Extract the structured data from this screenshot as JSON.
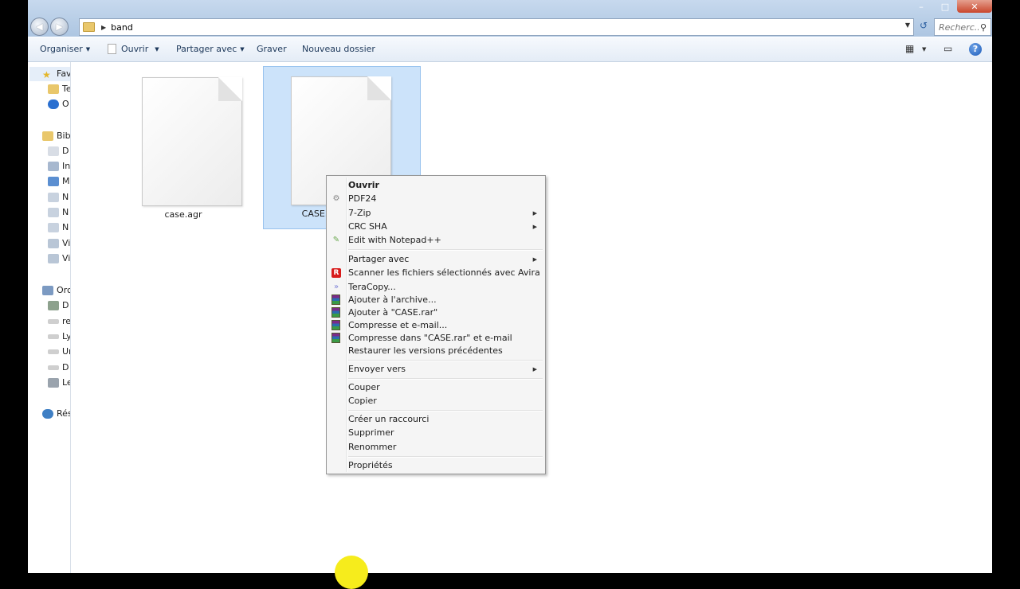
{
  "address": {
    "breadcrumb": [
      "band"
    ],
    "search_placeholder": "Recherc..."
  },
  "toolbar": {
    "organize": "Organiser",
    "open": "Ouvrir",
    "share": "Partager avec",
    "burn": "Graver",
    "new_folder": "Nouveau dossier"
  },
  "nav": {
    "favorites": "Fav",
    "fav_items": [
      "Te",
      "O"
    ],
    "libraries": "Bib",
    "lib_items": [
      "D",
      "In",
      "M",
      "N",
      "N",
      "N",
      "Vi",
      "Vi"
    ],
    "computer": "Orc",
    "computer_items": [
      "D",
      "re",
      "Ly",
      "Ur",
      "D",
      "Le"
    ],
    "network": "Rés"
  },
  "files": [
    {
      "name": "case.agr",
      "selected": false
    },
    {
      "name": "CASE.",
      "selected": true
    }
  ],
  "context_menu": {
    "items": [
      {
        "label": "Ouvrir",
        "bold": true
      },
      {
        "label": "PDF24",
        "icon": "pdf24-icon"
      },
      {
        "label": "7-Zip",
        "submenu": true
      },
      {
        "label": "CRC SHA",
        "submenu": true
      },
      {
        "label": "Edit with Notepad++",
        "icon": "notepadpp-icon"
      },
      {
        "label": "Partager avec",
        "submenu": true
      },
      {
        "label": "Scanner les fichiers sélectionnés avec Avira",
        "icon": "avira-icon"
      },
      {
        "label": "TeraCopy...",
        "icon": "teracopy-icon"
      },
      {
        "label": "Ajouter à l'archive...",
        "icon": "winrar-icon"
      },
      {
        "label": "Ajouter à \"CASE.rar\"",
        "icon": "winrar-icon"
      },
      {
        "label": "Compresse et e-mail...",
        "icon": "winrar-icon"
      },
      {
        "label": "Compresse dans \"CASE.rar\" et e-mail",
        "icon": "winrar-icon"
      },
      {
        "label": "Restaurer les versions précédentes"
      },
      {
        "label": "Envoyer vers",
        "submenu": true
      },
      {
        "label": "Couper"
      },
      {
        "label": "Copier"
      },
      {
        "label": "Créer un raccourci"
      },
      {
        "label": "Supprimer"
      },
      {
        "label": "Renommer"
      },
      {
        "label": "Propriétés"
      }
    ]
  },
  "colors": {
    "selection": "#cce3fa",
    "cursor_highlight": "#f6ec1c"
  }
}
